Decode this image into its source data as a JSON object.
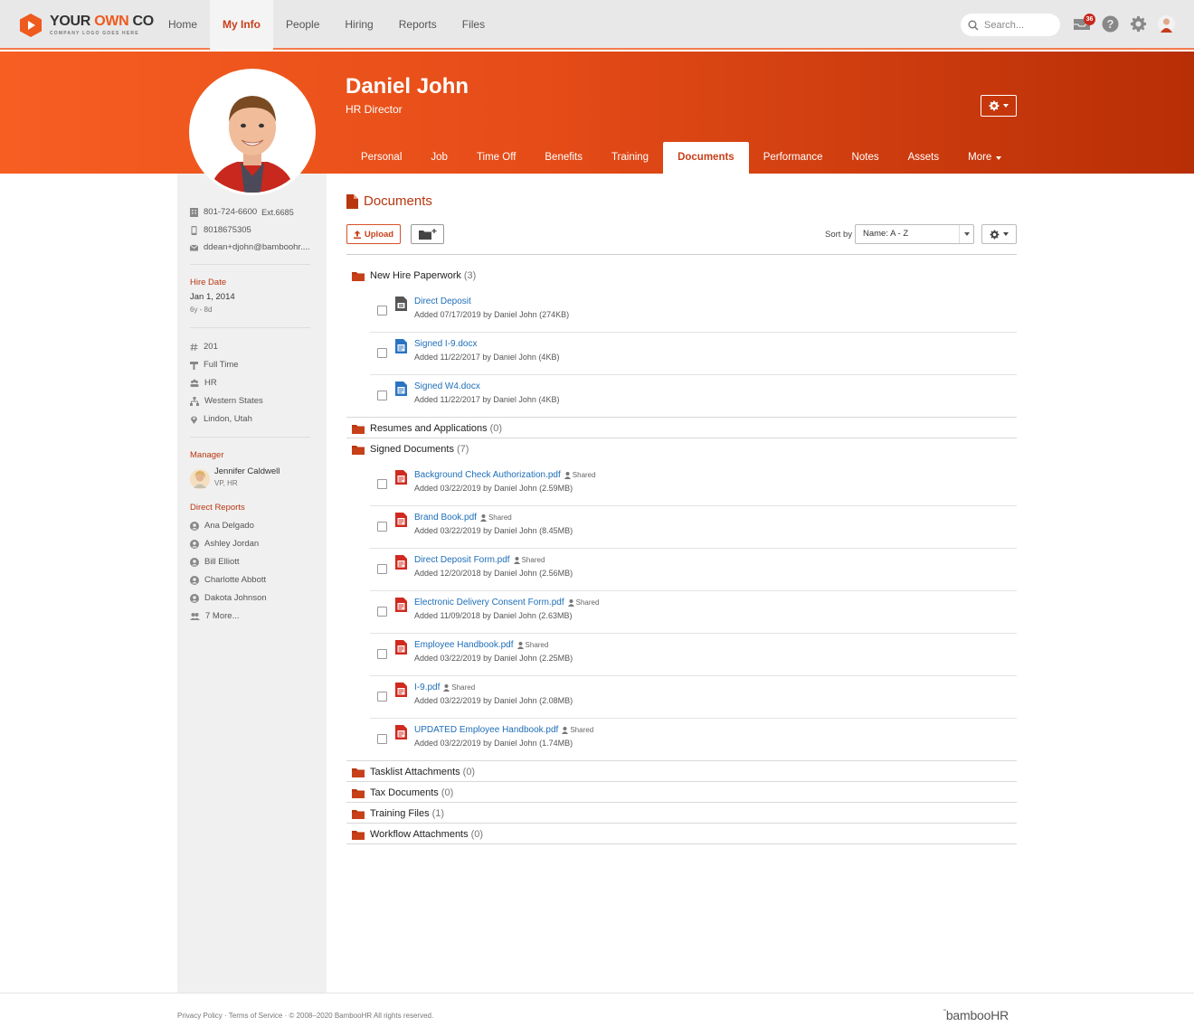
{
  "logo": {
    "name_part1": "YOUR ",
    "name_part2": "OWN",
    "name_part3": " CO",
    "tagline": "COMPANY LOGO GOES HERE"
  },
  "nav": [
    {
      "label": "Home",
      "active": false
    },
    {
      "label": "My Info",
      "active": true
    },
    {
      "label": "People",
      "active": false
    },
    {
      "label": "Hiring",
      "active": false
    },
    {
      "label": "Reports",
      "active": false
    },
    {
      "label": "Files",
      "active": false
    }
  ],
  "search": {
    "placeholder": "Search..."
  },
  "inbox_count": "36",
  "profile": {
    "name": "Daniel John",
    "job_title": "HR Director"
  },
  "tabs": [
    "Personal",
    "Job",
    "Time Off",
    "Benefits",
    "Training",
    "Documents",
    "Performance",
    "Notes",
    "Assets",
    "More"
  ],
  "active_tab": "Documents",
  "sidebar": {
    "work_phone": "801-724-6600",
    "extension": "Ext.6685",
    "mobile": "8018675305",
    "email": "ddean+djohn@bamboohr....",
    "hire_date_label": "Hire Date",
    "hire_date": "Jan 1, 2014",
    "tenure": "6y - 8d",
    "employee_number": "201",
    "employment_status": "Full Time",
    "department": "HR",
    "division": "Western States",
    "location": "Lindon, Utah",
    "manager_label": "Manager",
    "manager_name": "Jennifer Caldwell",
    "manager_title": "VP, HR",
    "direct_reports_label": "Direct Reports",
    "direct_reports": [
      "Ana Delgado",
      "Ashley Jordan",
      "Bill Elliott",
      "Charlotte Abbott",
      "Dakota Johnson"
    ],
    "more_reports": "7 More..."
  },
  "documents": {
    "title": "Documents",
    "upload_label": "Upload",
    "sort_label": "Sort by",
    "sort_value": "Name: A - Z",
    "shared_label": "Shared",
    "sections": [
      {
        "name": "New Hire Paperwork",
        "count": "(3)",
        "files": [
          {
            "name": "Direct Deposit",
            "meta": "Added 07/17/2019 by Daniel John (274KB)",
            "type": "generic",
            "shared": false
          },
          {
            "name": "Signed I-9.docx",
            "meta": "Added 11/22/2017 by Daniel John (4KB)",
            "type": "doc",
            "shared": false
          },
          {
            "name": "Signed W4.docx",
            "meta": "Added 11/22/2017 by Daniel John (4KB)",
            "type": "doc",
            "shared": false
          }
        ]
      },
      {
        "name": "Resumes and Applications",
        "count": "(0)",
        "files": []
      },
      {
        "name": "Signed Documents",
        "count": "(7)",
        "files": [
          {
            "name": "Background Check Authorization.pdf",
            "meta": "Added 03/22/2019 by Daniel John (2.59MB)",
            "type": "pdf",
            "shared": true
          },
          {
            "name": "Brand Book.pdf",
            "meta": "Added 03/22/2019 by Daniel John (8.45MB)",
            "type": "pdf",
            "shared": true
          },
          {
            "name": "Direct Deposit Form.pdf",
            "meta": "Added 12/20/2018 by Daniel John (2.56MB)",
            "type": "pdf",
            "shared": true
          },
          {
            "name": "Electronic Delivery Consent Form.pdf",
            "meta": "Added 11/09/2018 by Daniel John (2.63MB)",
            "type": "pdf",
            "shared": true
          },
          {
            "name": "Employee Handbook.pdf",
            "meta": "Added 03/22/2019 by Daniel John (2.25MB)",
            "type": "pdf",
            "shared": true
          },
          {
            "name": "I-9.pdf",
            "meta": "Added 03/22/2019 by Daniel John (2.08MB)",
            "type": "pdf",
            "shared": true
          },
          {
            "name": "UPDATED Employee Handbook.pdf",
            "meta": "Added 03/22/2019 by Daniel John (1.74MB)",
            "type": "pdf",
            "shared": true
          }
        ]
      },
      {
        "name": "Tasklist Attachments",
        "count": "(0)",
        "files": []
      },
      {
        "name": "Tax Documents",
        "count": "(0)",
        "files": []
      },
      {
        "name": "Training Files",
        "count": "(1)",
        "files": []
      },
      {
        "name": "Workflow Attachments",
        "count": "(0)",
        "files": []
      }
    ]
  },
  "footer": {
    "privacy": "Privacy Policy",
    "terms": "Terms of Service",
    "copyright": "© 2008–2020 BambooHR All rights reserved.",
    "brand": "bambooHR"
  },
  "colors": {
    "accent": "#c8401a",
    "hero_start": "#f65e22",
    "hero_end": "#b82e06",
    "link": "#1d6eb8"
  }
}
